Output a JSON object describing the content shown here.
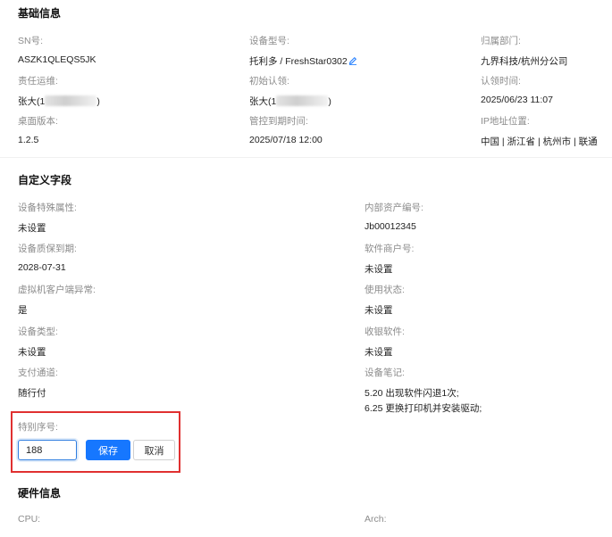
{
  "basic": {
    "title": "基础信息",
    "fields": [
      {
        "label": "SN号:",
        "value": "ASZK1QLEQS5JK"
      },
      {
        "label": "设备型号:",
        "value": "托利多 / FreshStar0302"
      },
      {
        "label": "归属部门:",
        "value": "九界科技/杭州分公司"
      },
      {
        "label": "责任运维:",
        "value": "张大(1",
        "suffix": ")"
      },
      {
        "label": "初始认领:",
        "value": "张大(1",
        "suffix": ")"
      },
      {
        "label": "认领时间:",
        "value": "2025/06/23 11:07"
      },
      {
        "label": "桌面版本:",
        "value": "1.2.5"
      },
      {
        "label": "管控到期时间:",
        "value": "2025/07/18 12:00"
      },
      {
        "label": "IP地址位置:",
        "value": "中国 | 浙江省 | 杭州市 | 联通"
      }
    ]
  },
  "custom": {
    "title": "自定义字段",
    "left": [
      {
        "label": "设备特殊属性:",
        "value": "未设置"
      },
      {
        "label": "设备质保到期:",
        "value": "2028-07-31"
      },
      {
        "label": "虚拟机客户端异常:",
        "value": "是"
      },
      {
        "label": "设备类型:",
        "value": "未设置"
      },
      {
        "label": "支付通道:",
        "value": "随行付"
      }
    ],
    "right": [
      {
        "label": "内部资产编号:",
        "value": "Jb00012345"
      },
      {
        "label": "软件商户号:",
        "value": "未设置"
      },
      {
        "label": "使用状态:",
        "value": "未设置"
      },
      {
        "label": "收银软件:",
        "value": "未设置"
      },
      {
        "label": "设备笔记:",
        "value": "5.20  出现软件闪退1次;",
        "value2": "6.25  更换打印机并安装驱动;"
      }
    ],
    "edit": {
      "label": "特别序号:",
      "value": "188",
      "save_label": "保存",
      "cancel_label": "取消"
    }
  },
  "hardware": {
    "title": "硬件信息",
    "cpu_label": "CPU:",
    "arch_label": "Arch:"
  },
  "colors": {
    "accent": "#1677ff",
    "highlight_border": "#e03030",
    "label": "#8c8c8c"
  },
  "icons": {
    "edit": "pencil-icon"
  }
}
